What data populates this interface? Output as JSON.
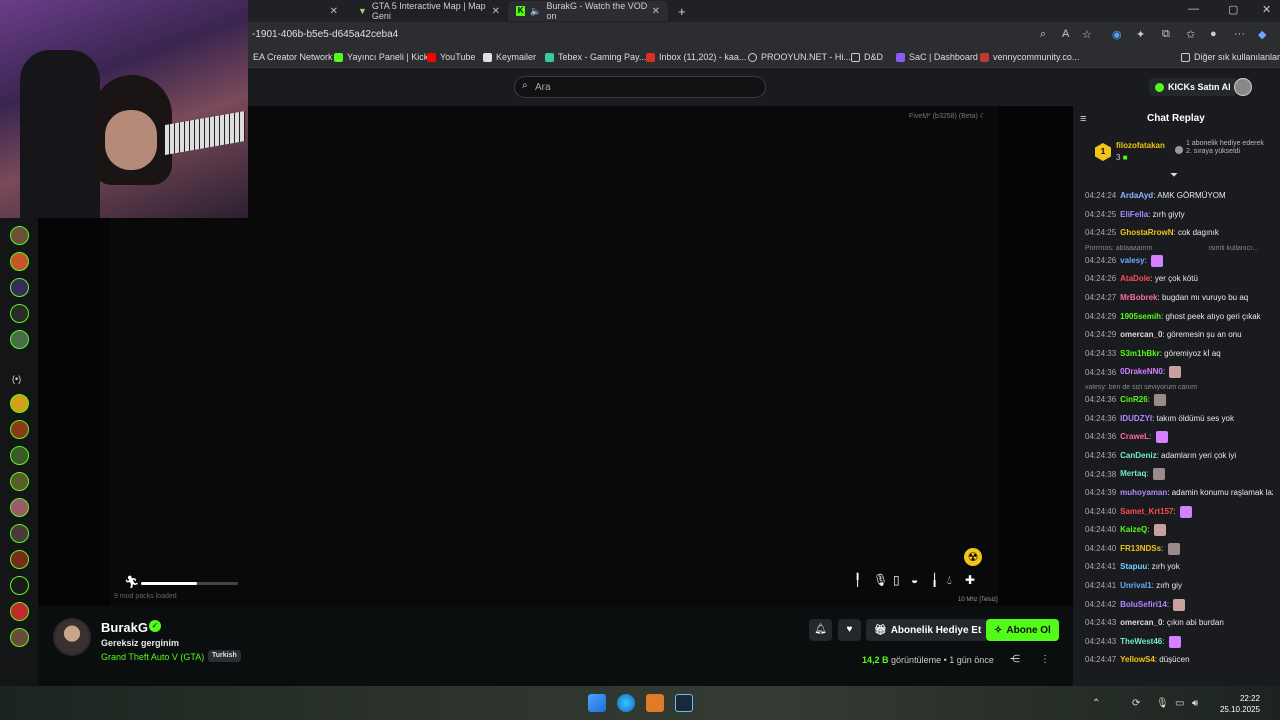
{
  "browser": {
    "tabs": [
      {
        "title": "GTA 5 Interactive Map | Map Genie",
        "display": "GTA 5 Interactive Map | Map Geni"
      },
      {
        "title": "BurakG - Watch the VOD on Kick",
        "display": "BurakG - Watch the VOD on"
      }
    ],
    "url": "-1901-406b-b5e5-d645a42ceba4",
    "bookmarks": [
      "EA Creator Network",
      "Yayıncı Paneli | Kick",
      "YouTube",
      "Keymailer",
      "Tebex - Gaming Pay...",
      "Inbox (11,202) - kaa...",
      "PROOYUN.NET - Hi...",
      "D&D",
      "SaC | Dashboard",
      "vennycommunity.co..."
    ],
    "other_bookmarks": "Diğer sık kullanılanlar"
  },
  "kick": {
    "search_placeholder": "Ara",
    "buy_kicks": "KICKs Satın Al"
  },
  "video": {
    "fivem_label": "FiveM* (b3258) (Beta)",
    "mods_loaded": "9 mod packs loaded",
    "stamina_fraction": 0.58,
    "radio_label": "10 Mhz [Telsiz]"
  },
  "stream": {
    "streamer": "BurakG",
    "title": "Gereksiz gerginim",
    "category": "Grand Theft Auto V (GTA)",
    "language": "Turkish",
    "gift_button": "Abonelik Hediye Et",
    "follow_button": "Abone Ol",
    "views_count": "14,2 B",
    "views_label": "görüntüleme",
    "separator": "•",
    "time_ago": "1 gün önce"
  },
  "chat": {
    "title": "Chat Replay",
    "pinned": {
      "rank": "1",
      "user": "filozofatakan",
      "count": "3",
      "text": "1 abonelik hediye ederek 2. sıraya yükseldi"
    },
    "messages": [
      {
        "time": "04:24:24",
        "user": "ArdaAyd",
        "color": "#8fb6ff",
        "text": "AMK GÖRMÜYOM"
      },
      {
        "time": "04:24:25",
        "user": "EliFella",
        "color": "#b388ff",
        "text": "zırh giyty"
      },
      {
        "time": "04:24:25",
        "user": "GhostaRrowN",
        "color": "#f0c419",
        "text": "cok dagınık"
      },
      {
        "time": "04:24:26",
        "user": "valesy",
        "color": "#6fa8ff",
        "text": "",
        "reply": "Porrrnos: ablaaaamm",
        "reply_tail": "isimli kullanıcı..."
      },
      {
        "time": "04:24:26",
        "user": "AtaDole",
        "color": "#ff4d4d",
        "text": "yer çok kötü"
      },
      {
        "time": "04:24:27",
        "user": "MrBobrek",
        "color": "#ff6b9a",
        "text": "bugdan mı vuruyo bu aq"
      },
      {
        "time": "04:24:29",
        "user": "1905semih",
        "color": "#53fc18",
        "text": "ghost peek atıyo geri çıkak"
      },
      {
        "time": "04:24:29",
        "user": "omercan_0",
        "color": "#dddddd",
        "text": "göremesin şu an onu"
      },
      {
        "time": "04:24:33",
        "user": "S3m1hBkr",
        "color": "#53fc18",
        "text": "göremiyoz kİ aq"
      },
      {
        "time": "04:24:36",
        "user": "0DrakeNN0",
        "color": "#d580ff",
        "text": ""
      },
      {
        "time": "04:24:36",
        "user": "CinR26",
        "color": "#53fc18",
        "text": "",
        "reply": "valesy: ben de sizi seviyorum canım"
      },
      {
        "time": "04:24:36",
        "user": "IDUDZYI",
        "color": "#b388ff",
        "text": "takım öldümü ses yok"
      },
      {
        "time": "04:24:36",
        "user": "CraweL",
        "color": "#ff6b9a",
        "text": ""
      },
      {
        "time": "04:24:36",
        "user": "CanDeniz",
        "color": "#6ff0c0",
        "text": "adamların yeri çok iyi"
      },
      {
        "time": "04:24:38",
        "user": "Mertaq",
        "color": "#6ff0c0",
        "text": ""
      },
      {
        "time": "04:24:39",
        "user": "muhoyaman",
        "color": "#b388ff",
        "text": "adamin konumu raşlamak lazim"
      },
      {
        "time": "04:24:40",
        "user": "Samet_Krt157",
        "color": "#ff4d4d",
        "text": ""
      },
      {
        "time": "04:24:40",
        "user": "KaizeQ",
        "color": "#53fc18",
        "text": ""
      },
      {
        "time": "04:24:40",
        "user": "FR13NDSs",
        "color": "#f0c419",
        "text": ""
      },
      {
        "time": "04:24:41",
        "user": "Stapuu",
        "color": "#6fd0ff",
        "text": "zırh yok"
      },
      {
        "time": "04:24:41",
        "user": "Unrival1",
        "color": "#6fa8ff",
        "text": "zırh giy"
      },
      {
        "time": "04:24:42",
        "user": "BoluSefiri14",
        "color": "#b388ff",
        "text": ""
      },
      {
        "time": "04:24:43",
        "user": "omercan_0",
        "color": "#dddddd",
        "text": "çıkın abi burdan"
      },
      {
        "time": "04:24:43",
        "user": "TheWest46",
        "color": "#6ff0c0",
        "text": ""
      },
      {
        "time": "04:24:47",
        "user": "YellowS4",
        "color": "#f0c419",
        "text": "düşücen"
      }
    ]
  },
  "taskbar": {
    "time": "22:22",
    "date": "25.10.2025"
  }
}
